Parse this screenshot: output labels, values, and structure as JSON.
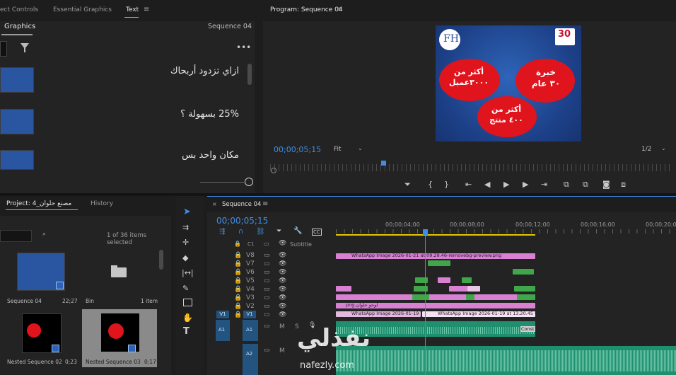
{
  "effects_panel": {
    "tabs": [
      "ect Controls",
      "Essential Graphics",
      "Text"
    ],
    "subtab": "Graphics",
    "sequence_label": "Sequence 04",
    "items": [
      {
        "text": "ازاي تزدود أربحاك"
      },
      {
        "text": "25% بسهولة ؟"
      },
      {
        "text": "مكان واحد بس"
      }
    ],
    "more_icon": "ellipsis-icon"
  },
  "program_monitor": {
    "title": "Program: Sequence 04",
    "timecode": "00;00;05;15",
    "fit": "Fit",
    "resolution": "1/2",
    "frame": {
      "logo_text": "FH",
      "badge_number": "30",
      "bubble1": "خبرة\n٣٠ عام",
      "bubble2": "أكثر من\n٣٠٠٠عميل",
      "bubble3": "أكثر من\n٤٠٠ منتج"
    }
  },
  "project_panel": {
    "tabs": [
      "Project: مصنع حلوان_4",
      "History"
    ],
    "selection_info": "1 of 36 items selected",
    "items": [
      {
        "name": "Sequence 04",
        "duration": "22;27"
      },
      {
        "name": "Bin",
        "duration": "1 item"
      },
      {
        "name": "Nested Sequence 02",
        "duration": "0;23"
      },
      {
        "name": "Nested Sequence 03",
        "duration": "0;17"
      }
    ]
  },
  "timeline": {
    "tab": "Sequence 04",
    "timecode": "00;00;05;15",
    "ruler": [
      "00;00;04;00",
      "00;00;08;00",
      "00;00;12;00",
      "00;00;16;00",
      "00;00;20;00"
    ],
    "subtitle_label": "Subtitle",
    "c1_label": "C1",
    "video_tracks": [
      "V8",
      "V7",
      "V6",
      "V5",
      "V4",
      "V3",
      "V2",
      "V1"
    ],
    "audio_tracks": [
      "A1",
      "A2"
    ],
    "source_patch_v": "V1",
    "source_patch_a": "A1",
    "clip_v8": "WhatsApp Image 2026-01-21 at 09.28.46-removebg-preview.png",
    "clip_v2": "لوجو حلوان.png",
    "clip_v1a": "WhatsApp Image 2026-01-19",
    "clip_v1b": "WhatsApp Image 2026-01-19 at 13.20.45 (",
    "clip_a1": "Const",
    "mute_label": "M",
    "solo_label": "S"
  },
  "watermark": {
    "text": "nafezly.com",
    "arabic": "نفذلي"
  }
}
